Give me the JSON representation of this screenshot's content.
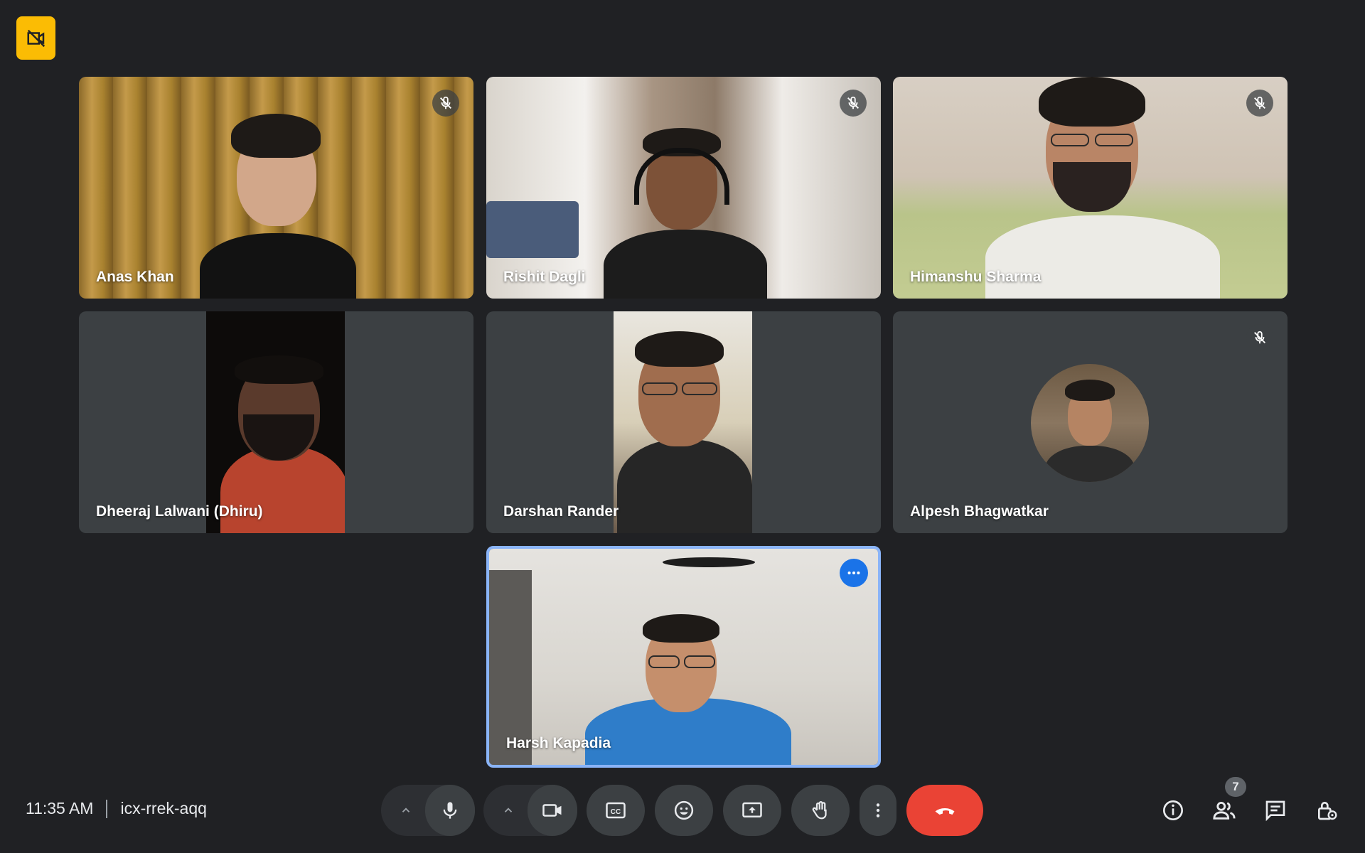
{
  "meeting": {
    "time": "11:35 AM",
    "code": "icx-rrek-aqq",
    "participant_count": "7"
  },
  "participants": [
    {
      "name": "Anas Khan",
      "muted": true
    },
    {
      "name": "Rishit Dagli",
      "muted": true
    },
    {
      "name": "Himanshu Sharma",
      "muted": true
    },
    {
      "name": "Dheeraj Lalwani (Dhiru)",
      "muted": false
    },
    {
      "name": "Darshan Rander",
      "muted": false
    },
    {
      "name": "Alpesh Bhagwatkar",
      "muted": true
    },
    {
      "name": "Harsh Kapadia",
      "muted": false,
      "self": true
    }
  ],
  "icons": {
    "corner": "camera-off-icon",
    "controls": [
      "chevron-up-icon",
      "microphone-icon",
      "chevron-up-icon",
      "camera-icon",
      "captions-icon",
      "emoji-icon",
      "present-screen-icon",
      "raise-hand-icon",
      "more-vert-icon",
      "end-call-icon"
    ],
    "right": [
      "info-icon",
      "people-icon",
      "chat-icon",
      "host-controls-icon"
    ]
  },
  "colors": {
    "background": "#202124",
    "tile": "#3c4043",
    "self_border": "#8ab4f8",
    "end_call": "#ea4335",
    "corner_badge": "#fbbc04",
    "accent": "#1a73e8"
  }
}
